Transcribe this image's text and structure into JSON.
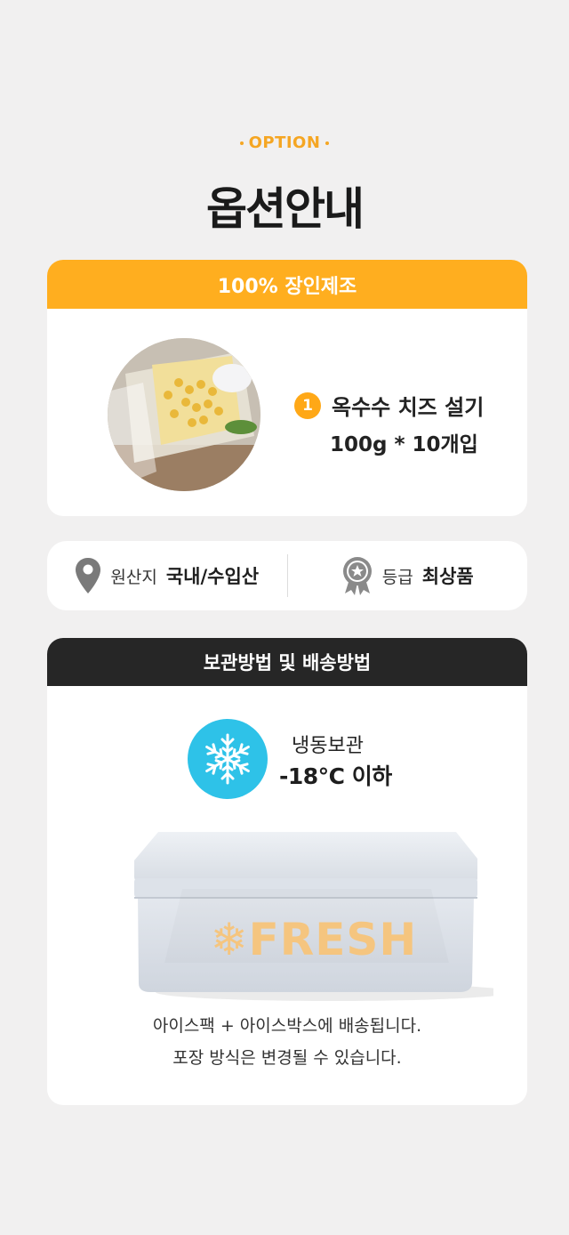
{
  "header": {
    "eyebrow": "OPTION",
    "title": "옵션안내"
  },
  "option_card": {
    "banner": "100% 장인제조",
    "item_number": "1",
    "item_name": "옥수수 치즈 설기",
    "item_qty": "100g * 10개입"
  },
  "info": {
    "origin_icon": "location-pin-icon",
    "origin_label": "원산지",
    "origin_value": "국내/수입산",
    "grade_icon": "award-badge-icon",
    "grade_label": "등급",
    "grade_value": "최상품"
  },
  "storage_card": {
    "banner": "보관방법 및 배송방법",
    "icon": "snowflake-icon",
    "freeze_line1": "냉동보관",
    "freeze_line2": "-18°C 이하",
    "box_label": "FRESH",
    "shipping_line1": "아이스팩 + 아이스박스에 배송됩니다.",
    "shipping_line2": "포장 방식은 변경될 수 있습니다."
  },
  "colors": {
    "accent": "#ffae1f",
    "dark": "#262626",
    "ice": "#2ec2e8",
    "background": "#f1f0f0"
  }
}
